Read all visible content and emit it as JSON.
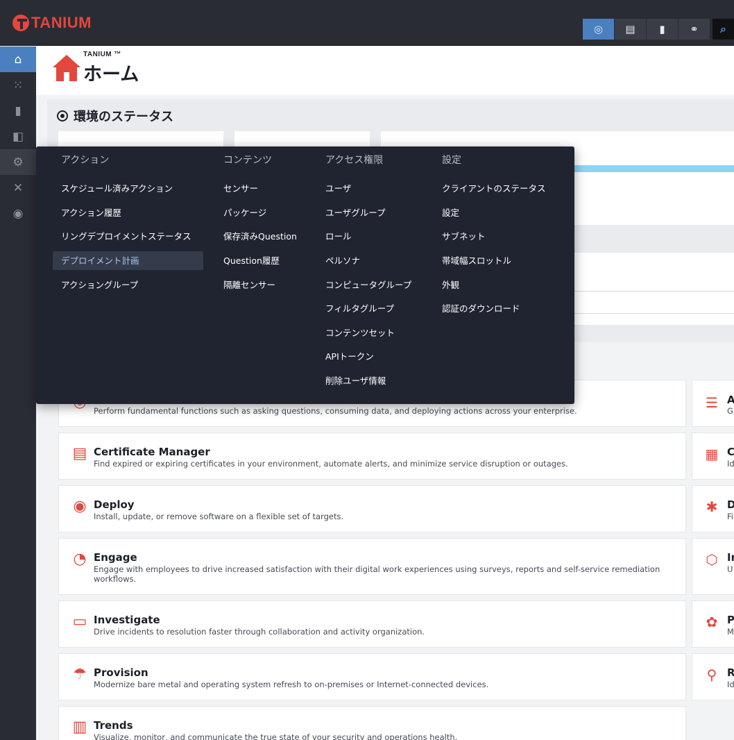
{
  "topbar": {
    "brand": "TANIUM",
    "icons": [
      "crosshair-icon",
      "dashboard-icon",
      "bar-chart-icon",
      "link-icon"
    ],
    "search_icon": "search-icon"
  },
  "sidebar": {
    "items": [
      "home-icon",
      "apps-grid-icon",
      "bar-chart-icon",
      "layers-icon",
      "gears-icon",
      "tools-icon",
      "compass-icon"
    ]
  },
  "header": {
    "brand_small": "TANIUM ™",
    "title": "ホーム"
  },
  "status": {
    "title": "環境のステータス"
  },
  "menu": {
    "columns": [
      {
        "heading": "アクション",
        "items": [
          "スケジュール済みアクション",
          "アクション履歴",
          "リングデプロイメントステータス",
          "デプロイメント計画",
          "アクショングループ"
        ],
        "selected_index": 3
      },
      {
        "heading": "コンテンツ",
        "items": [
          "センサー",
          "パッケージ",
          "保存済みQuestion",
          "Question履歴",
          "隔離センサー"
        ]
      },
      {
        "heading": "アクセス権限",
        "items": [
          "ユーザ",
          "ユーザグループ",
          "ロール",
          "ペルソナ",
          "コンピュータグループ",
          "フィルタグループ",
          "コンテンツセット",
          "APIトークン",
          "削除ユーザ情報"
        ]
      },
      {
        "heading": "設定",
        "items": [
          "クライアントのステータス",
          "設定",
          "サブネット",
          "帯域幅スロットル",
          "外観",
          "認証のダウンロード"
        ]
      }
    ]
  },
  "modules": [
    {
      "title": "",
      "desc": "Perform fundamental functions such as asking questions, consuming data, and deploying actions across your enterprise."
    },
    {
      "title": "Certificate Manager",
      "desc": "Find expired or expiring certificates in your environment, automate alerts, and minimize service disruption or outages."
    },
    {
      "title": "Deploy",
      "desc": "Install, update, or remove software on a flexible set of targets."
    },
    {
      "title": "Engage",
      "desc": "Engage with employees to drive increased satisfaction with their digital work experiences using surveys, reports and self-service remediation workflows."
    },
    {
      "title": "Investigate",
      "desc": "Drive incidents to resolution faster through collaboration and activity organization."
    },
    {
      "title": "Provision",
      "desc": "Modernize bare metal and operating system refresh to on-premises or Internet-connected devices."
    },
    {
      "title": "Trends",
      "desc": "Visualize, monitor, and communicate the true state of your security and operations health."
    }
  ],
  "modules_right": [
    {
      "title": "A",
      "desc": "G"
    },
    {
      "title": "C",
      "desc": "Id"
    },
    {
      "title": "D",
      "desc": "Fi"
    },
    {
      "title": "In",
      "desc": "U"
    },
    {
      "title": "P",
      "desc": "M"
    },
    {
      "title": "R",
      "desc": "Id"
    }
  ]
}
